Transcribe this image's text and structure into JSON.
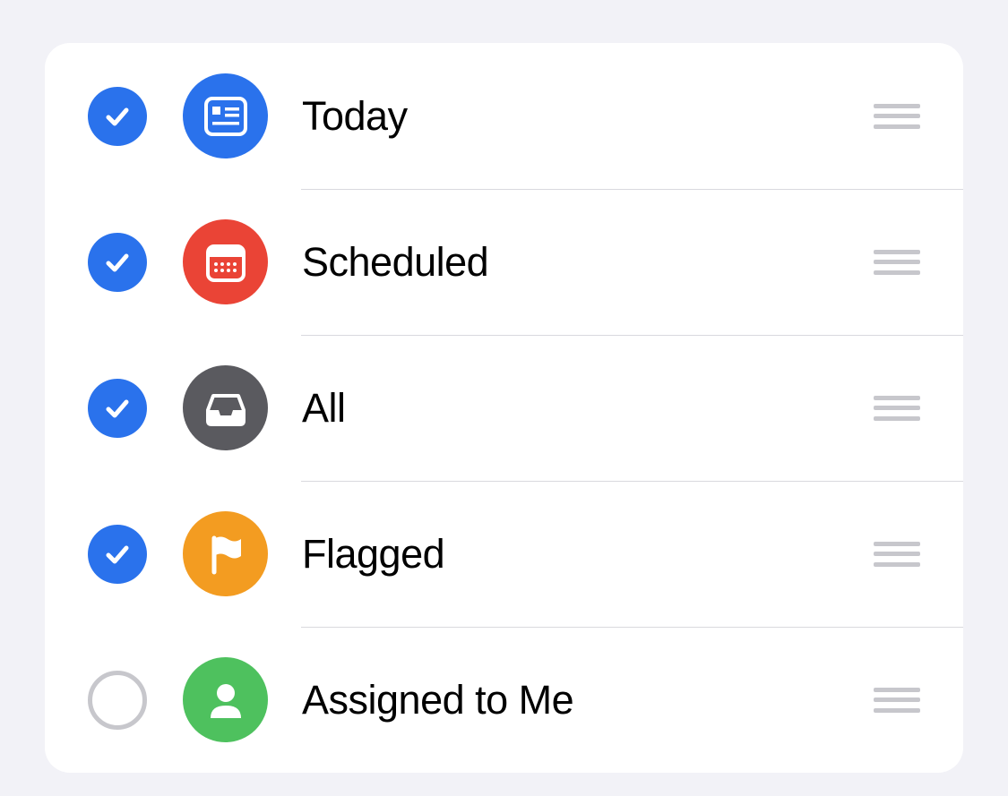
{
  "categories": [
    {
      "id": "today",
      "label": "Today",
      "checked": true,
      "iconColor": "#2a72ec",
      "icon": "today"
    },
    {
      "id": "scheduled",
      "label": "Scheduled",
      "checked": true,
      "iconColor": "#ea4436",
      "icon": "calendar"
    },
    {
      "id": "all",
      "label": "All",
      "checked": true,
      "iconColor": "#5a5a5f",
      "icon": "tray"
    },
    {
      "id": "flagged",
      "label": "Flagged",
      "checked": true,
      "iconColor": "#f39c21",
      "icon": "flag"
    },
    {
      "id": "assigned",
      "label": "Assigned to Me",
      "checked": false,
      "iconColor": "#4ec15e",
      "icon": "person"
    }
  ]
}
